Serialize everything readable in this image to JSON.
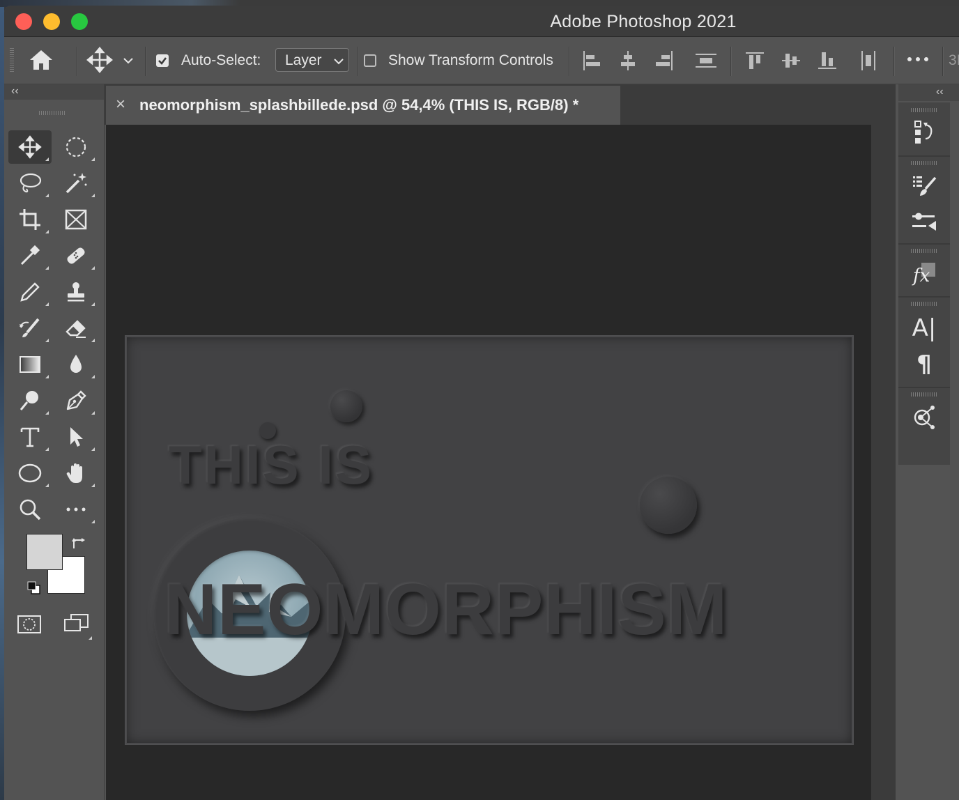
{
  "window": {
    "title": "Adobe Photoshop 2021"
  },
  "options_bar": {
    "auto_select_label": "Auto-Select:",
    "auto_select_checked": true,
    "layer_select_value": "Layer",
    "show_transform_label": "Show Transform Controls",
    "show_transform_checked": false,
    "cut_off_text": "3I"
  },
  "document": {
    "tab_title": "neomorphism_splashbillede.psd @ 54,4% (THIS IS, RGB/8) *",
    "close_glyph": "×",
    "artwork": {
      "line1": "THIS IS",
      "line2": "NEOMORPHISM"
    }
  },
  "toolbar": {
    "collapse_glyph": "‹‹",
    "tools": [
      {
        "name": "move-tool",
        "icon": "move-icon"
      },
      {
        "name": "marquee-tool",
        "icon": "elliptical-marquee-icon"
      },
      {
        "name": "lasso-tool",
        "icon": "lasso-icon"
      },
      {
        "name": "magic-wand-tool",
        "icon": "magic-wand-icon"
      },
      {
        "name": "crop-tool",
        "icon": "crop-icon"
      },
      {
        "name": "frame-tool",
        "icon": "frame-icon"
      },
      {
        "name": "eyedropper-tool",
        "icon": "eyedropper-icon"
      },
      {
        "name": "healing-brush-tool",
        "icon": "bandage-icon"
      },
      {
        "name": "pencil-tool",
        "icon": "pencil-icon"
      },
      {
        "name": "stamp-tool",
        "icon": "stamp-icon"
      },
      {
        "name": "history-brush-tool",
        "icon": "history-brush-icon"
      },
      {
        "name": "eraser-tool",
        "icon": "eraser-icon"
      },
      {
        "name": "gradient-tool",
        "icon": "gradient-icon"
      },
      {
        "name": "blur-tool",
        "icon": "drop-icon"
      },
      {
        "name": "dodge-tool",
        "icon": "dodge-icon"
      },
      {
        "name": "pen-tool",
        "icon": "pen-icon"
      },
      {
        "name": "type-tool",
        "icon": "type-icon"
      },
      {
        "name": "path-selection-tool",
        "icon": "arrow-cursor-icon"
      },
      {
        "name": "ellipse-tool",
        "icon": "ellipse-icon"
      },
      {
        "name": "hand-tool",
        "icon": "hand-icon"
      },
      {
        "name": "zoom-tool",
        "icon": "magnifier-icon"
      },
      {
        "name": "more-tools",
        "icon": "more-icon"
      }
    ],
    "foreground_color": "#d5d5d5",
    "background_color": "#ffffff"
  },
  "right_panel": {
    "collapse_glyph": "‹‹",
    "type_glyph": "A|",
    "paragraph_glyph": "¶",
    "fx_glyph": "fx"
  },
  "colors": {
    "close": "#fe5f57",
    "minimize": "#febc2e",
    "maximize": "#28c840",
    "canvas_bg": "#282828",
    "artwork_bg": "#424244"
  }
}
